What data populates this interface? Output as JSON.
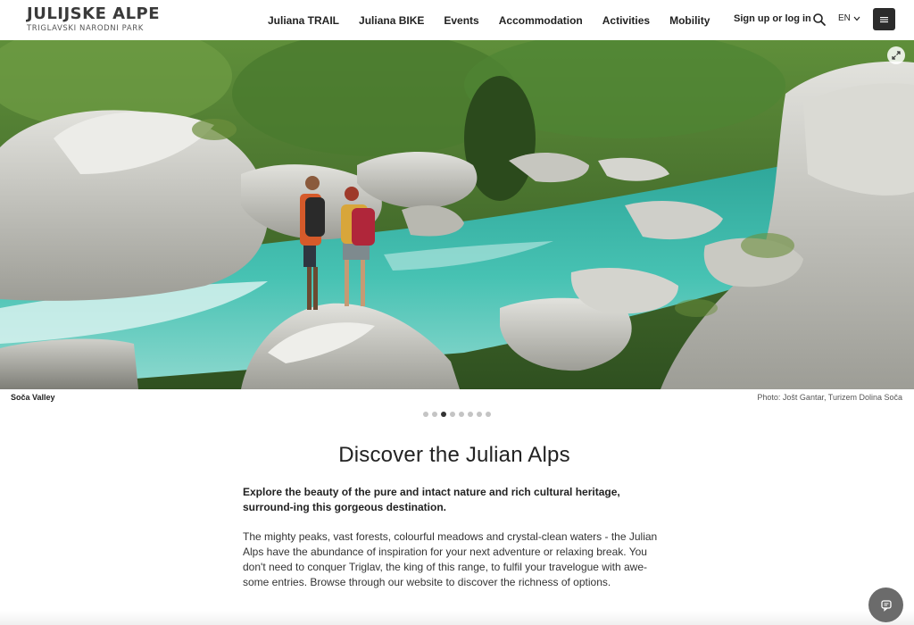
{
  "logo": {
    "title": "JULIJSKE ALPE",
    "subtitle": "TRIGLAVSKI NARODNI PARK"
  },
  "nav": {
    "items": [
      {
        "label": "Juliana TRAIL"
      },
      {
        "label": "Juliana BIKE"
      },
      {
        "label": "Events"
      },
      {
        "label": "Accommodation"
      },
      {
        "label": "Activities"
      },
      {
        "label": "Mobility"
      }
    ]
  },
  "header": {
    "auth_label": "Sign up or log in",
    "search_icon": "search-icon",
    "language": "EN",
    "menu_icon": "hamburger-icon"
  },
  "hero": {
    "caption": "Soča Valley",
    "credit": "Photo: Jošt Gantar, Turizem Dolina Soča",
    "slide_count": 8,
    "active_slide": 3
  },
  "content": {
    "title": "Discover the Julian Alps",
    "lead": "Explore the beauty of the pure and intact nature and rich cultural heritage, surround-ing this gorgeous destination.",
    "body": "The mighty peaks, vast forests, colourful meadows and crystal-clean waters - the Julian Alps have the abundance of inspiration for your next adventure or relaxing break.  You don't need to conquer Triglav, the king of this range, to fulfil your travelogue with awe-some entries. Browse through our website to discover the richness of options."
  },
  "colors": {
    "river": "#3fb5a8",
    "forest": "#3f6b2a",
    "rock": "#c9c9c4",
    "menu_button": "#2b2b2b",
    "chat_button": "#6b6b6b"
  }
}
